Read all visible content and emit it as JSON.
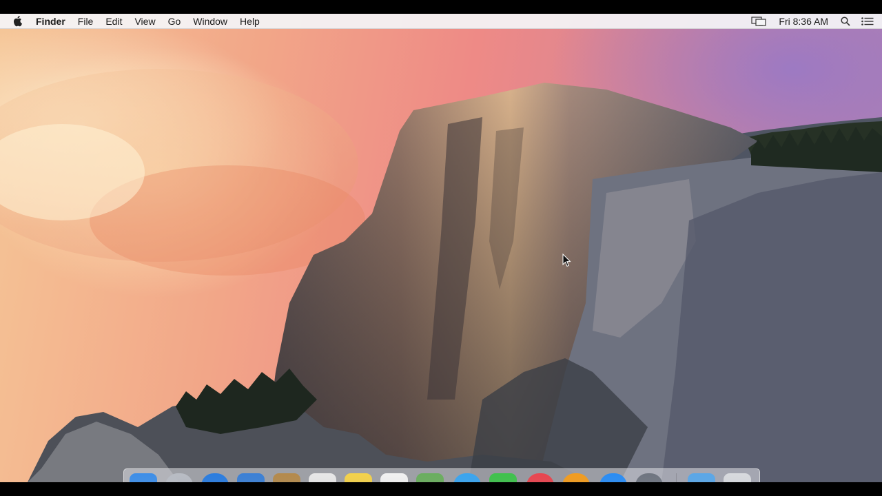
{
  "menubar": {
    "app_name": "Finder",
    "menus": [
      "File",
      "Edit",
      "View",
      "Go",
      "Window",
      "Help"
    ],
    "clock": "Fri 8:36 AM"
  },
  "icons": {
    "apple": "apple-icon",
    "display": "display-mirroring-icon",
    "search": "spotlight-search-icon",
    "notifications": "notification-center-icon"
  },
  "dock": {
    "apps": [
      "finder",
      "launchpad",
      "safari",
      "mail",
      "contacts",
      "calendar",
      "notes",
      "reminders",
      "maps",
      "messages",
      "facetime",
      "itunes",
      "ibooks",
      "app-store",
      "system-preferences",
      "downloads-folder",
      "trash"
    ],
    "apps_colors": [
      "#3d8ee8",
      "#b8bcc4",
      "#2a7de0",
      "#3b80d6",
      "#b48a4c",
      "#e8e8e8",
      "#f4d24a",
      "#f2f2f2",
      "#6aae5e",
      "#3aa5f0",
      "#3fc24c",
      "#e9454f",
      "#f29c1e",
      "#2a8df5",
      "#6f7580",
      "#5aa7e8",
      "#d8dade"
    ]
  }
}
